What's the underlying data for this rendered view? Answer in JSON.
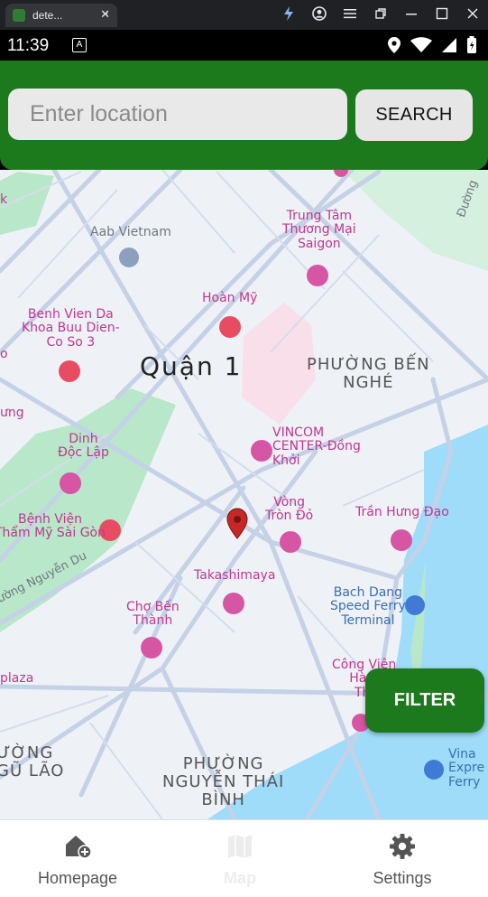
{
  "browser": {
    "tab_title": "dete...",
    "tab_close": "✕",
    "tab_dropdown": "⌄"
  },
  "status_bar": {
    "time": "11:39",
    "a_icon_text": "A"
  },
  "header": {
    "location_placeholder": "Enter location",
    "search_label": "SEARCH",
    "color": "#1c7a1c"
  },
  "map": {
    "labels": {
      "aab_vietnam": "Aab Vietnam",
      "trung_tam": "Trung Tâm\nThương Mại\nSaigon",
      "hoan_my": "Hoàn Mỹ",
      "benh_vien_da_khoa": "Benh Vien Da\nKhoa Buu Dien-\nCo So 3",
      "quan1": "Quận 1",
      "phuong_ben_nghe": "PHƯỜNG BẾN\nNGHÉ",
      "vincom": "VINCOM\nCENTER-Đồng\nKhởi",
      "dinh_doc_lap": "Dinh\nĐộc Lập",
      "vong_tron_do": "Vòng\nTròn Đỏ",
      "tran_hung_dao": "Trần Hưng Đạo",
      "benh_vien_tham_my": "Bệnh Viện\nThẩm Mỹ Sài Gòn",
      "takashimaya": "Takashimaya",
      "cho_ben_thanh": "Chợ Bến\nThành",
      "bach_dang": "Bach Dang\nSpeed Ferry\nTerminal",
      "cong_vien_ham_thi": "Công Viên\nHàm\nThi",
      "plaza": "plaza",
      "phuong_nguyen_thai_binh": "PHƯỜNG\nNGUYỄN THÁI\nBÌNH",
      "vina_express": "Vina\nExpre\nFerry",
      "phuong_ngu_lao": "ƯỜNG\nGŨ LÃO",
      "nguyen_du": "Đường Nguyễn Du",
      "duong_right": "Đường",
      "left_k": "k",
      "left_tung": "ưng",
      "left_o": "o"
    }
  },
  "filter_label": "FILTER",
  "bottom_nav": {
    "items": [
      {
        "label": "Homepage",
        "icon": "home-add-icon"
      },
      {
        "label": "Map",
        "icon": "map-icon"
      },
      {
        "label": "Settings",
        "icon": "gear-icon"
      }
    ]
  },
  "colors": {
    "accent": "#1c7a1c",
    "water": "#9fdcf9",
    "park": "#b9e7c9",
    "poi_pink": "#c2358f",
    "road": "#c4d1e6"
  }
}
